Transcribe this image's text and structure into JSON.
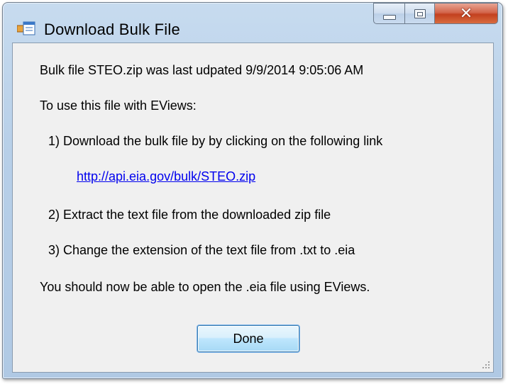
{
  "window": {
    "title": "Download Bulk File",
    "icon": "windows-form-icon",
    "buttons": {
      "minimize": "minimize-icon",
      "maximize": "maximize-icon",
      "close": "close-icon"
    }
  },
  "content": {
    "last_updated": "Bulk file STEO.zip was last udpated 9/9/2014 9:05:06 AM",
    "intro": "To use this file with EViews:",
    "step1": "1) Download the bulk file by by clicking on the following link",
    "link": "http://api.eia.gov/bulk/STEO.zip",
    "step2": "2) Extract the text file from the downloaded zip file",
    "step3": "3) Change the extension of the text file from .txt to .eia",
    "closing": "You should now be able to open the .eia file using EViews."
  },
  "done_label": "Done",
  "colors": {
    "link": "#0000ee",
    "client_background": "#f0f0f0",
    "close_button": "#c3401f",
    "frame": "#b7cfe8"
  }
}
